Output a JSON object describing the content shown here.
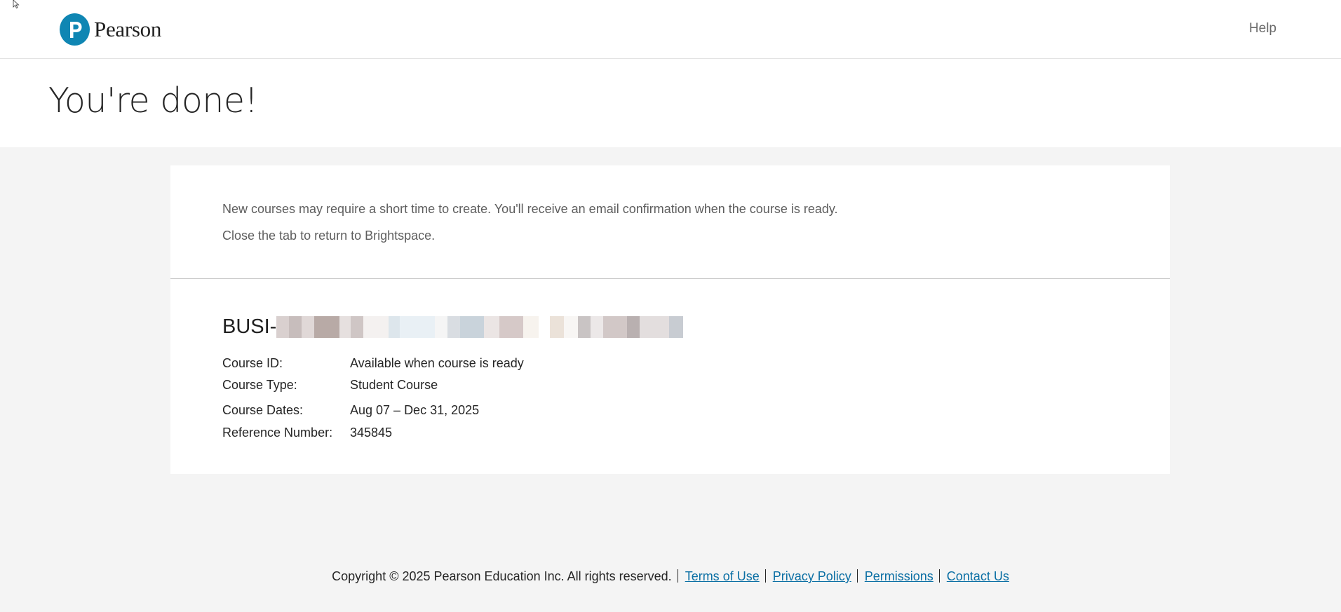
{
  "header": {
    "logo_text": "Pearson",
    "help_label": "Help"
  },
  "page": {
    "title": "You're done!"
  },
  "notice": {
    "line1": "New courses may require a short time to create. You'll receive an email confirmation when the course is ready.",
    "line2": "Close the tab to return to Brightspace."
  },
  "course": {
    "name_prefix": "BUSI-",
    "details": [
      {
        "label": "Course ID:",
        "value": "Available when course is ready"
      },
      {
        "label": "Course Type:",
        "value": "Student Course"
      },
      {
        "label": "Course Dates:",
        "value": "Aug 07 – Dec 31, 2025"
      },
      {
        "label": "Reference Number:",
        "value": "345845"
      }
    ]
  },
  "footer": {
    "copyright": "Copyright © 2025 Pearson Education Inc. All rights reserved.",
    "links": [
      "Terms of Use",
      "Privacy Policy",
      "Permissions",
      "Contact Us"
    ]
  },
  "colors": {
    "brand": "#0f86b3",
    "link": "#0b6fa4",
    "background": "#f4f4f4"
  }
}
